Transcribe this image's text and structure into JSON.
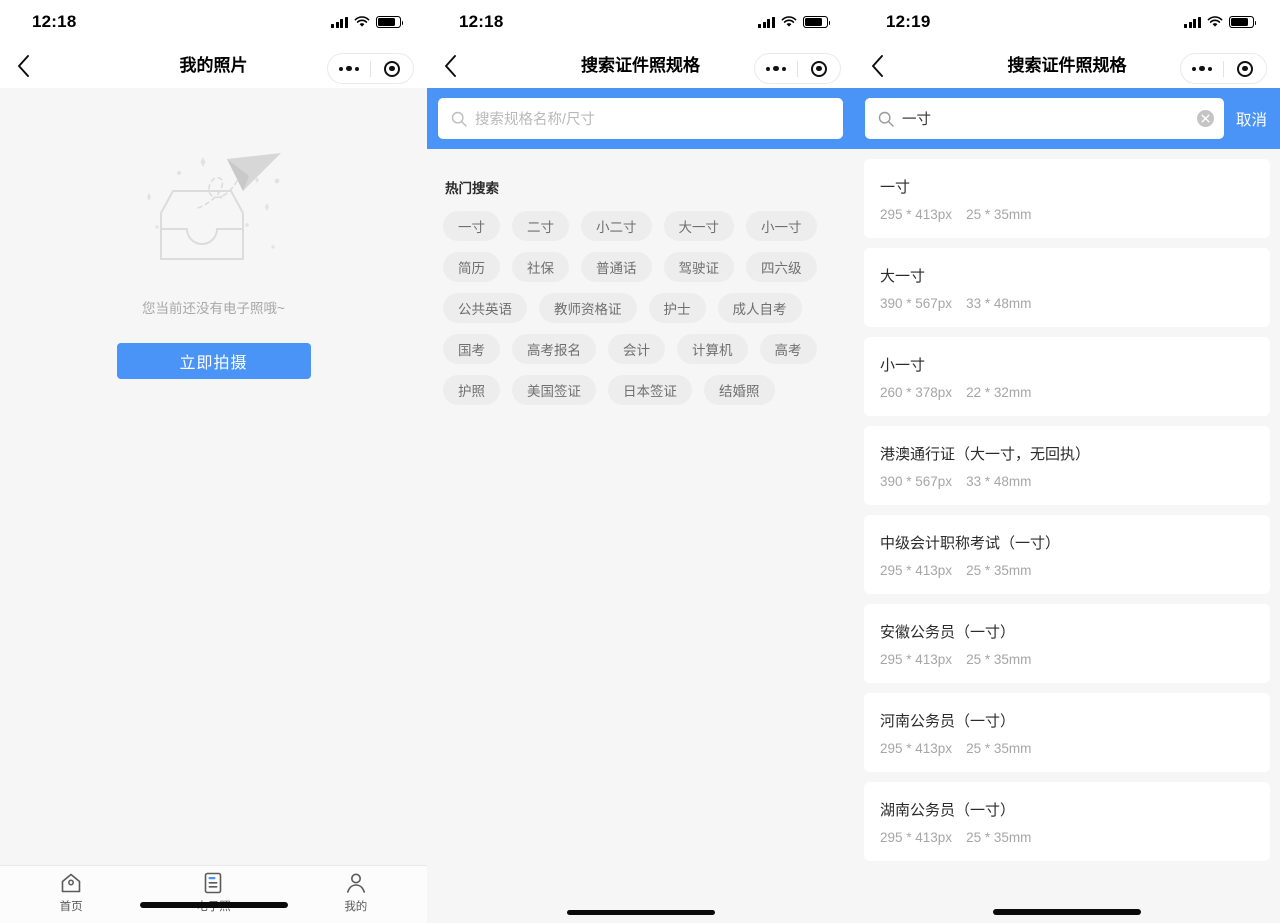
{
  "screens": {
    "photos": {
      "status": {
        "time": "12:18"
      },
      "nav": {
        "title": "我的照片"
      },
      "empty": {
        "text": "您当前还没有电子照哦~",
        "button": "立即拍摄"
      },
      "tabs": [
        {
          "label": "首页",
          "icon": "home-icon",
          "active": false
        },
        {
          "label": "电子照",
          "icon": "document-icon",
          "active": true
        },
        {
          "label": "我的",
          "icon": "person-icon",
          "active": false
        }
      ]
    },
    "search_empty": {
      "status": {
        "time": "12:18"
      },
      "nav": {
        "title": "搜索证件照规格"
      },
      "search": {
        "placeholder": "搜索规格名称/尺寸",
        "value": ""
      },
      "hot": {
        "title": "热门搜索",
        "rows": [
          [
            "一寸",
            "二寸",
            "小二寸",
            "大一寸",
            "小一寸"
          ],
          [
            "简历",
            "社保",
            "普通话",
            "驾驶证",
            "四六级"
          ],
          [
            "公共英语",
            "教师资格证",
            "护士",
            "成人自考"
          ],
          [
            "国考",
            "高考报名",
            "会计",
            "计算机",
            "高考"
          ],
          [
            "护照",
            "美国签证",
            "日本签证",
            "结婚照"
          ]
        ]
      }
    },
    "search_results": {
      "status": {
        "time": "12:19"
      },
      "nav": {
        "title": "搜索证件照规格"
      },
      "search": {
        "value": "一寸",
        "cancel": "取消",
        "clear_icon": "clear-circle-icon"
      },
      "results": [
        {
          "name": "一寸",
          "px": "295 * 413px",
          "mm": "25 * 35mm"
        },
        {
          "name": "大一寸",
          "px": "390 * 567px",
          "mm": "33 * 48mm"
        },
        {
          "name": "小一寸",
          "px": "260 * 378px",
          "mm": "22 * 32mm"
        },
        {
          "name": "港澳通行证（大一寸，无回执）",
          "px": "390 * 567px",
          "mm": "33 * 48mm"
        },
        {
          "name": "中级会计职称考试（一寸）",
          "px": "295 * 413px",
          "mm": "25 * 35mm"
        },
        {
          "name": "安徽公务员（一寸）",
          "px": "295 * 413px",
          "mm": "25 * 35mm"
        },
        {
          "name": "河南公务员（一寸）",
          "px": "295 * 413px",
          "mm": "25 * 35mm"
        },
        {
          "name": "湖南公务员（一寸）",
          "px": "295 * 413px",
          "mm": "25 * 35mm"
        }
      ]
    }
  },
  "colors": {
    "accent": "#4a93f7",
    "page_bg": "#f6f6f6",
    "card": "#ffffff",
    "tag_bg": "#ededed"
  }
}
